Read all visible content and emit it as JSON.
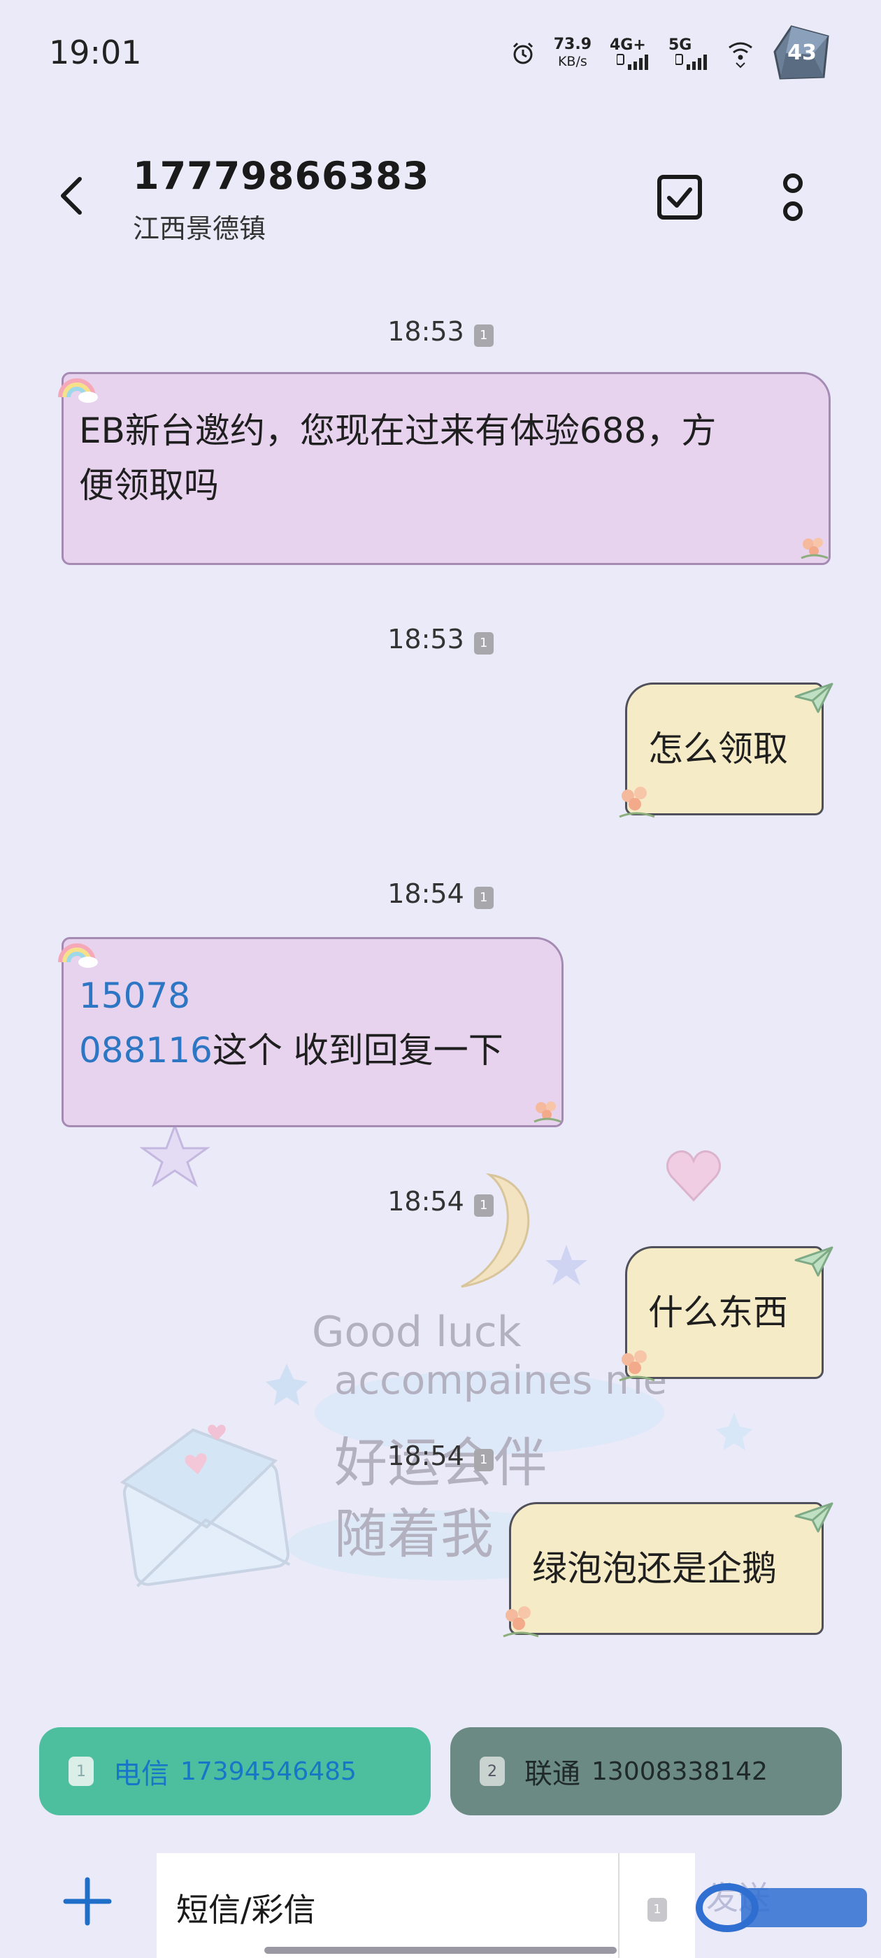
{
  "status_bar": {
    "time": "19:01",
    "net_speed_value": "73.9",
    "net_speed_unit": "KB/s",
    "sim1_network": "4G+",
    "sim2_network": "5G",
    "battery_level": "43"
  },
  "header": {
    "contact_number": "17779866383",
    "contact_location": "江西景德镇"
  },
  "messages": [
    {
      "time": "18:53",
      "sim": "1",
      "direction": "incoming",
      "lines": [
        "EB新台邀约，您现在过来有体验688，方",
        "便领取吗"
      ]
    },
    {
      "time": "18:53",
      "sim": "1",
      "direction": "outgoing",
      "text": "怎么领取"
    },
    {
      "time": "18:54",
      "sim": "1",
      "direction": "incoming",
      "link_line1": "15078",
      "link_line2": "088116",
      "text_after_link": "这个 收到回复一下"
    },
    {
      "time": "18:54",
      "sim": "1",
      "direction": "outgoing",
      "text": "什么东西"
    },
    {
      "time": "18:54",
      "sim": "1",
      "direction": "outgoing",
      "text": "绿泡泡还是企鹅"
    }
  ],
  "background_art": {
    "line1": "Good luck",
    "line2": "accompaines me",
    "line3": "好运会伴",
    "line4": "随着我"
  },
  "sim_selector": {
    "sim1": {
      "slot": "1",
      "carrier": "电信",
      "number": "17394546485"
    },
    "sim2": {
      "slot": "2",
      "carrier": "联通",
      "number": "13008338142"
    }
  },
  "compose": {
    "placeholder": "短信/彩信",
    "sim_slot": "1",
    "send_label": "发送"
  },
  "colors": {
    "background": "#ebeaf8",
    "incoming_bubble": "#e8d3ef",
    "outgoing_bubble": "#f5ebc6",
    "link": "#2d76c4",
    "sim1_button": "#4ebf9e",
    "sim2_button": "#6b8a84"
  }
}
